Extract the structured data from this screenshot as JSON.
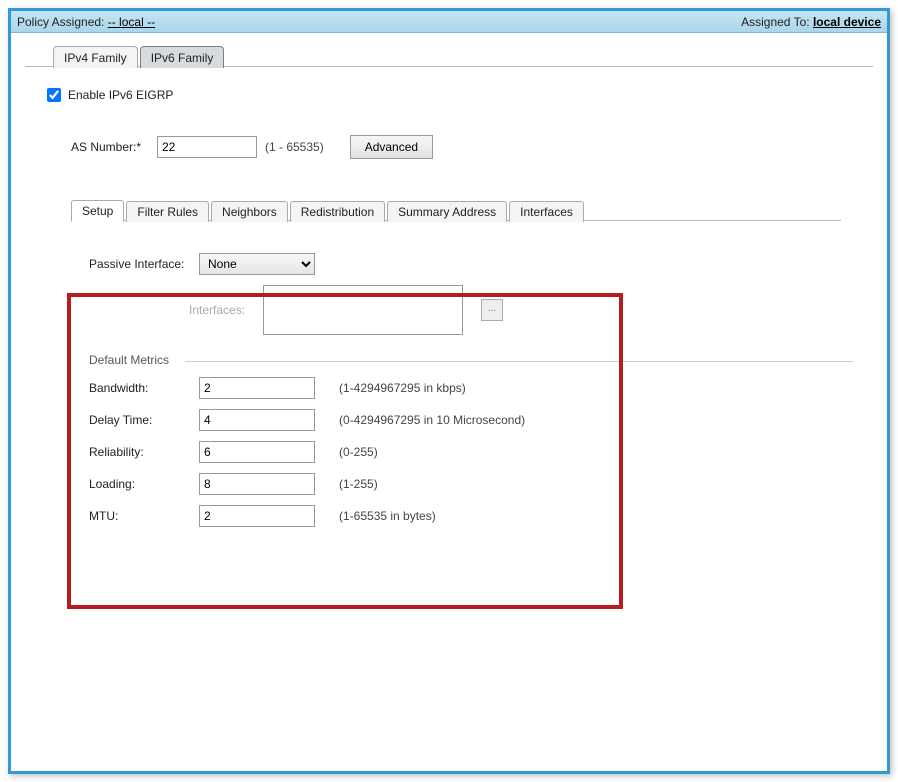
{
  "header": {
    "policy_assigned_label": "Policy Assigned:",
    "policy_assigned_value": "-- local --",
    "assigned_to_label": "Assigned To:",
    "assigned_to_value": "local device"
  },
  "top_tabs": {
    "ipv4": "IPv4 Family",
    "ipv6": "IPv6 Family"
  },
  "enable_checkbox": {
    "label": "Enable IPv6 EIGRP",
    "checked": true
  },
  "as_number": {
    "label": "AS Number:*",
    "value": "22",
    "hint": "(1 - 65535)"
  },
  "advanced_button": "Advanced",
  "sub_tabs": {
    "setup": "Setup",
    "filter_rules": "Filter Rules",
    "neighbors": "Neighbors",
    "redistribution": "Redistribution",
    "summary_address": "Summary Address",
    "interfaces": "Interfaces"
  },
  "setup": {
    "passive_interface_label": "Passive Interface:",
    "passive_interface_value": "None",
    "interfaces_label": "Interfaces:",
    "ellipsis": "...",
    "default_metrics_title": "Default Metrics",
    "metrics": {
      "bandwidth": {
        "label": "Bandwidth:",
        "value": "2",
        "hint": "(1-4294967295 in kbps)"
      },
      "delay_time": {
        "label": "Delay Time:",
        "value": "4",
        "hint": "(0-4294967295 in 10 Microsecond)"
      },
      "reliability": {
        "label": "Reliability:",
        "value": "6",
        "hint": "(0-255)"
      },
      "loading": {
        "label": "Loading:",
        "value": "8",
        "hint": "(1-255)"
      },
      "mtu": {
        "label": "MTU:",
        "value": "2",
        "hint": "(1-65535 in bytes)"
      }
    }
  }
}
